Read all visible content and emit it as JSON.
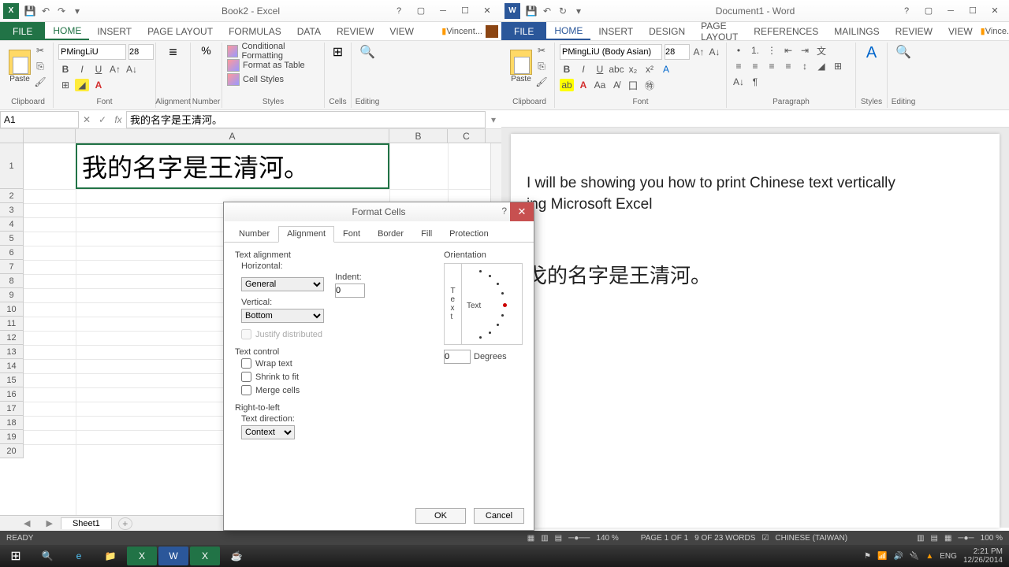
{
  "excel": {
    "title": "Book2 - Excel",
    "qat": [
      "save",
      "undo",
      "redo"
    ],
    "tabs": [
      "FILE",
      "HOME",
      "INSERT",
      "PAGE LAYOUT",
      "FORMULAS",
      "DATA",
      "REVIEW",
      "VIEW"
    ],
    "active_tab": "HOME",
    "user": "Vincent...",
    "ribbon": {
      "clipboard_label": "Clipboard",
      "paste_label": "Paste",
      "font_label": "Font",
      "font_name": "PMingLiU",
      "font_size": "28",
      "alignment_label": "Alignment",
      "number_label": "Number",
      "styles_label": "Styles",
      "cond_format": "Conditional Formatting",
      "as_table": "Format as Table",
      "cell_styles": "Cell Styles",
      "cells_label": "Cells",
      "editing_label": "Editing"
    },
    "name_box": "A1",
    "formula_text": "我的名字是王清河。",
    "cell_a1": "我的名字是王清河。",
    "columns": [
      "A",
      "B",
      "C"
    ],
    "rows": [
      1,
      2,
      3,
      4,
      5,
      6,
      7,
      8,
      9,
      10,
      11,
      12,
      13,
      14,
      15,
      16,
      17,
      18,
      19,
      20
    ],
    "sheet_name": "Sheet1",
    "status": "READY"
  },
  "word": {
    "title": "Document1 - Word",
    "tabs": [
      "FILE",
      "HOME",
      "INSERT",
      "DESIGN",
      "PAGE LAYOUT",
      "REFERENCES",
      "MAILINGS",
      "REVIEW",
      "VIEW"
    ],
    "active_tab": "HOME",
    "user": "Vince...",
    "ribbon": {
      "clipboard_label": "Clipboard",
      "paste_label": "Paste",
      "font_label": "Font",
      "font_name": "PMingLiU (Body Asian)",
      "font_size": "28",
      "paragraph_label": "Paragraph",
      "styles_label": "Styles",
      "editing_label": "Editing"
    },
    "para1": "I will be showing you how to print Chinese text vertically",
    "para2": "ing Microsoft Excel",
    "para3": "戈的名字是王清河。"
  },
  "dialog": {
    "title": "Format Cells",
    "tabs": [
      "Number",
      "Alignment",
      "Font",
      "Border",
      "Fill",
      "Protection"
    ],
    "active_tab": "Alignment",
    "text_alignment": "Text alignment",
    "horizontal_label": "Horizontal:",
    "horizontal_value": "General",
    "indent_label": "Indent:",
    "indent_value": "0",
    "vertical_label": "Vertical:",
    "vertical_value": "Bottom",
    "justify_dist": "Justify distributed",
    "text_control": "Text control",
    "wrap": "Wrap text",
    "shrink": "Shrink to fit",
    "merge": "Merge cells",
    "rtl": "Right-to-left",
    "text_dir_label": "Text direction:",
    "text_dir_value": "Context",
    "orientation": "Orientation",
    "orient_text": "Text",
    "degrees_label": "Degrees",
    "degrees_value": "0",
    "ok": "OK",
    "cancel": "Cancel"
  },
  "statusbar": {
    "zoom_excel": "140 %",
    "page": "PAGE 1 OF 1",
    "words": "9 OF 23 WORDS",
    "lang": "CHINESE (TAIWAN)",
    "zoom_word": "100 %"
  },
  "taskbar": {
    "time": "2:21 PM",
    "date": "12/26/2014",
    "lang": "ENG"
  }
}
